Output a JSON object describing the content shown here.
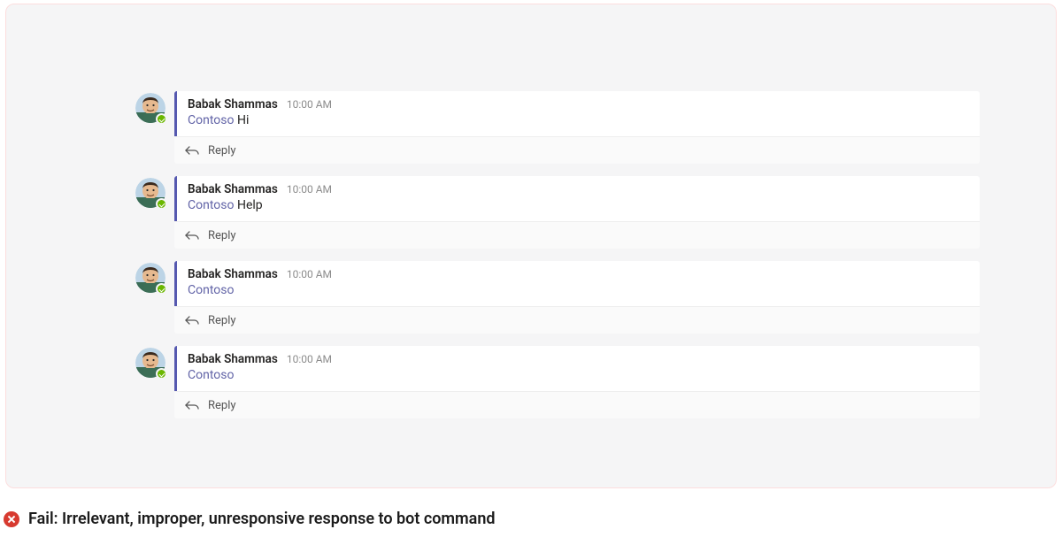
{
  "posts": [
    {
      "author": "Babak Shammas",
      "time": "10:00 AM",
      "mention": "Contoso",
      "text": "Hi",
      "reply_label": "Reply"
    },
    {
      "author": "Babak Shammas",
      "time": "10:00 AM",
      "mention": "Contoso",
      "text": "Help",
      "reply_label": "Reply"
    },
    {
      "author": "Babak Shammas",
      "time": "10:00 AM",
      "mention": "Contoso",
      "text": "",
      "reply_label": "Reply"
    },
    {
      "author": "Babak Shammas",
      "time": "10:00 AM",
      "mention": "Contoso",
      "text": "",
      "reply_label": "Reply"
    }
  ],
  "caption": "Fail: Irrelevant, improper, unresponsive response to bot command"
}
